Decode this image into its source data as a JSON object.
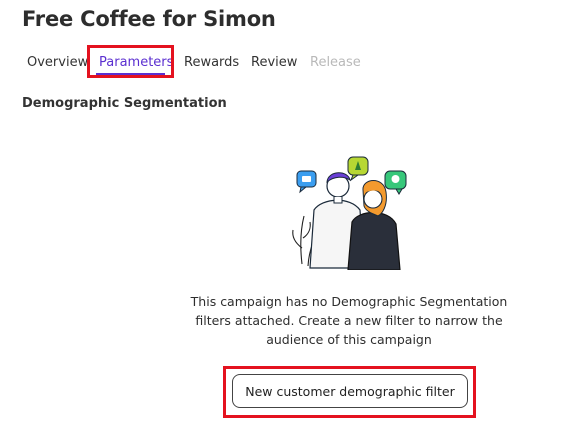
{
  "page": {
    "title": "Free Coffee for Simon"
  },
  "tabs": [
    {
      "label": "Overview",
      "state": "default"
    },
    {
      "label": "Parameters",
      "state": "active"
    },
    {
      "label": "Rewards",
      "state": "default"
    },
    {
      "label": "Review",
      "state": "default"
    },
    {
      "label": "Release",
      "state": "disabled"
    }
  ],
  "section": {
    "title": "Demographic Segmentation"
  },
  "empty_state": {
    "illustration": "people-with-chat-bubbles-illustration",
    "message": "This campaign has no Demographic Segmentation filters attached. Create a new filter to narrow the audience of this campaign",
    "button_label": "New customer demographic filter"
  },
  "colors": {
    "accent": "#5b2fd0",
    "highlight": "#e4121f",
    "disabled": "#b9b9b9"
  }
}
